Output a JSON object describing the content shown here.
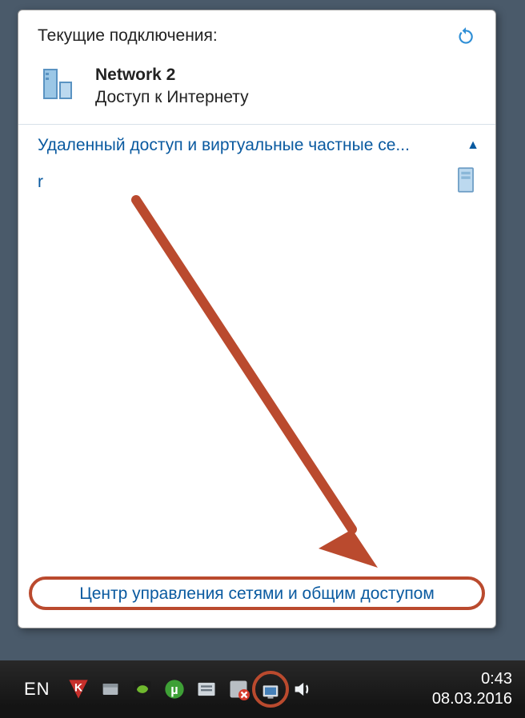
{
  "popup": {
    "title": "Текущие подключения:",
    "connection": {
      "name": "Network  2",
      "status": "Доступ к Интернету"
    },
    "section_vpn_title": "Удаленный доступ и виртуальные частные се...",
    "vpn_item": "r",
    "bottom_link": "Центр управления сетями и общим доступом"
  },
  "taskbar": {
    "lang": "EN",
    "clock": {
      "time": "0:43",
      "date": "08.03.2016"
    }
  },
  "icons": {
    "refresh": "refresh-icon",
    "network": "network-icon",
    "server": "server-icon",
    "chevron_up": "chevron-up-icon",
    "kaspersky": "kaspersky-icon",
    "dropbox": "dropbox-icon",
    "nvidia": "nvidia-icon",
    "utorrent": "utorrent-icon",
    "warning": "warning-icon",
    "network_tray": "network-tray-icon",
    "volume": "volume-icon"
  }
}
